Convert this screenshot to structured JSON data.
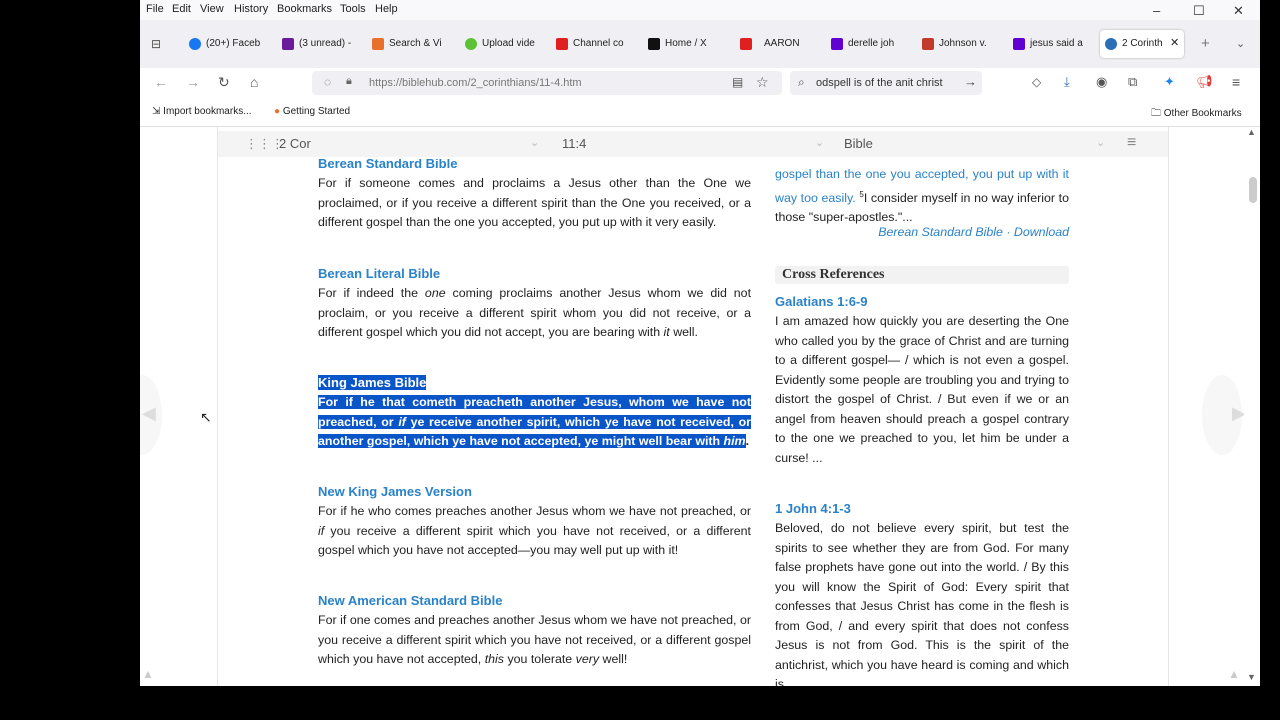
{
  "menu": [
    "File",
    "Edit",
    "View",
    "History",
    "Bookmarks",
    "Tools",
    "Help"
  ],
  "tabs": [
    {
      "label": "(20+) Faceb",
      "color": "#1877f2"
    },
    {
      "label": "(3 unread) -",
      "color": "#6a1b9a"
    },
    {
      "label": "Search & Vi",
      "color": "#e8702a"
    },
    {
      "label": "Upload vide",
      "color": "#5bc236"
    },
    {
      "label": "Channel co",
      "color": "#e02020"
    },
    {
      "label": "Home / X",
      "color": "#111111"
    },
    {
      "label": "AARON",
      "color": "#e02020"
    },
    {
      "label": "derelle joh",
      "color": "#6001d2"
    },
    {
      "label": "Johnson v.",
      "color": "#c0392b"
    },
    {
      "label": "jesus said a",
      "color": "#6001d2"
    },
    {
      "label": "2 Corinth",
      "color": "#2a6fb8"
    }
  ],
  "nav": {
    "url": "https://biblehub.com/2_corinthians/11-4.htm",
    "search": "odspell is of the anit christ"
  },
  "bookmarks": {
    "import": "Import bookmarks...",
    "started": "Getting Started",
    "other": "Other Bookmarks"
  },
  "topnav": {
    "book": "2 Cor",
    "verse": "11:4",
    "version": "Bible"
  },
  "left": [
    {
      "heading": "Berean Standard Bible",
      "text": "For if someone comes and proclaims a Jesus other than the One we proclaimed, or if you receive a different spirit than the One you received, or a different gospel than the one you accepted, you put up with it very easily."
    },
    {
      "heading": "Berean Literal Bible",
      "text_pre": "For if indeed the ",
      "text_em": "one",
      "text_post": " coming proclaims another Jesus whom we did not proclaim, or you receive a different spirit whom you did not receive, or a different gospel which you did not accept, you are bearing with ",
      "text_em2": "it",
      "text_end": " well."
    },
    {
      "heading": "King James Bible",
      "text_pre": "For if he that cometh preacheth another Jesus, whom we have not preached, or ",
      "text_em": "if",
      "text_post": " ye receive another spirit, which ye have not received, or another gospel, which ye have not accepted, ye might well bear with ",
      "text_em2": "him",
      "text_end": "."
    },
    {
      "heading": "New King James Version",
      "text_pre": "For if he who comes preaches another Jesus whom we have not preached, or ",
      "text_em": "if",
      "text_post": " you receive a different spirit which you have not received, or a different gospel which you have not accepted—you may well put up with it!"
    },
    {
      "heading": "New American Standard Bible",
      "text_pre": "For if one comes and preaches another Jesus whom we have not preached, or you receive a different spirit which you have not received, or a different gospel which you have not accepted, ",
      "text_em": "this",
      "text_post": " you tolerate ",
      "text_em2": "very",
      "text_end": " well!"
    }
  ],
  "right": {
    "context_link": "gospel than the one you accepted, you put up with it way too easily.",
    "context_sup": "5",
    "context_rest": "I consider myself in no way inferior to those \"super-apostles.\"...",
    "attribution": "Berean Standard Bible · Download",
    "xref_title": "Cross References",
    "refs": [
      {
        "ref": "Galatians 1:6-9",
        "text": "I am amazed how quickly you are deserting the One who called you by the grace of Christ and are turning to a different gospel— / which is not even a gospel. Evidently some people are troubling you and trying to distort the gospel of Christ. / But even if we or an angel from heaven should preach a gospel contrary to the one we preached to you, let him be under a curse! ..."
      },
      {
        "ref": "1 John 4:1-3",
        "text": "Beloved, do not believe every spirit, but test the spirits to see whether they are from God. For many false prophets have gone out into the world. / By this you will know the Spirit of God: Every spirit that confesses that Jesus Christ has come in the flesh is from God, / and every spirit that does not confess Jesus is not from God. This is the spirit of the antichrist, which you have heard is coming and which is"
      }
    ]
  }
}
